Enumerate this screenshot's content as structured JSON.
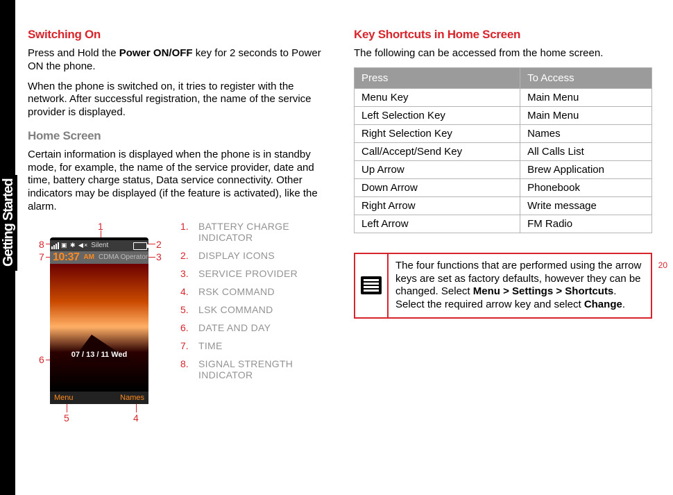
{
  "side_label": "Getting Started",
  "page_number": "20",
  "left": {
    "h1": "Switching On",
    "p1a": "Press and Hold the ",
    "p1b": "Power ON/OFF",
    "p1c": " key for 2 seconds to Power ON the phone.",
    "p2": "When the phone is switched on, it tries to register with the network. After successful registration, the name of the service provider is displayed.",
    "h2": "Home Screen",
    "p3": "Certain information is displayed when the phone is in standby mode, for example, the name of the service provider, date and time, battery charge status, Data service connectivity. Other indicators may be displayed (if the feature is activated), like the alarm."
  },
  "phone": {
    "silent": "Silent",
    "time": "10:37",
    "ampm": "AM",
    "provider": "CDMA Operator",
    "date": "07 / 13 / 11 Wed",
    "lsk": "Menu",
    "rsk": "Names"
  },
  "callouts": {
    "n1": "1",
    "n2": "2",
    "n3": "3",
    "n4": "4",
    "n5": "5",
    "n6": "6",
    "n7": "7",
    "n8": "8"
  },
  "legend": [
    {
      "num": "1.",
      "label": "BATTERY CHARGE INDICATOR"
    },
    {
      "num": "2.",
      "label": "DISPLAY ICONS"
    },
    {
      "num": "3.",
      "label": "SERVICE PROVIDER"
    },
    {
      "num": "4.",
      "label": "RSK COMMAND"
    },
    {
      "num": "5.",
      "label": "LSK COMMAND"
    },
    {
      "num": "6.",
      "label": "DATE AND DAY"
    },
    {
      "num": "7.",
      "label": "TIME"
    },
    {
      "num": "8.",
      "label": "SIGNAL STRENGTH INDICATOR"
    }
  ],
  "right": {
    "h1": "Key Shortcuts in Home Screen",
    "p1": "The following can be accessed from the home screen.",
    "th1": "Press",
    "th2": "To Access",
    "rows": [
      {
        "press": "Menu  Key",
        "access": "Main Menu"
      },
      {
        "press": "Left Selection Key",
        "access": "Main Menu"
      },
      {
        "press": "Right Selection Key",
        "access": "Names"
      },
      {
        "press": "Call/Accept/Send Key",
        "access": "All Calls List"
      },
      {
        "press": "Up Arrow",
        "access": "Brew Application"
      },
      {
        "press": "Down Arrow",
        "access": "Phonebook"
      },
      {
        "press": "Right Arrow",
        "access": "Write message"
      },
      {
        "press": "Left Arrow",
        "access": "FM Radio"
      }
    ],
    "note_a": "The four functions that are performed using the arrow keys are set as factory defaults, however they can be changed. Select ",
    "note_b": "Menu > Settings > Shortcuts",
    "note_c": ". Select the required arrow key and select ",
    "note_d": "Change",
    "note_e": "."
  }
}
